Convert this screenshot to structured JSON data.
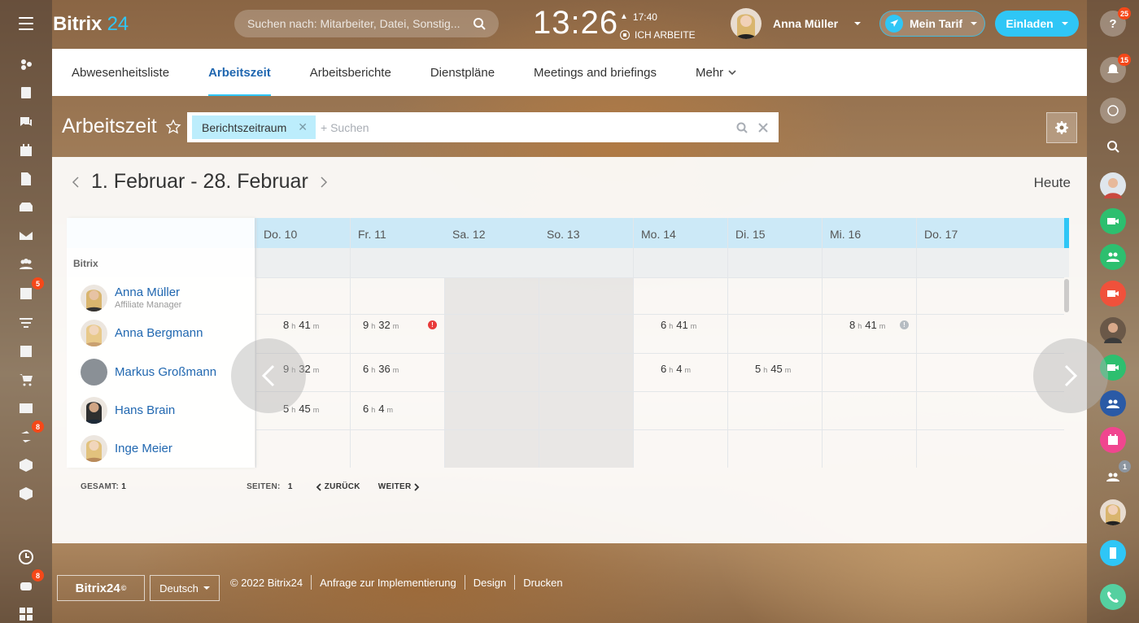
{
  "header": {
    "logo_main": "Bitrix",
    "logo_num": "24",
    "search_placeholder": "Suchen nach: Mitarbeiter, Datei, Sonstig...",
    "clock": "13:26",
    "alarm_time": "17:40",
    "work_status": "ICH ARBEITE",
    "user_name": "Anna Müller",
    "tarif_label": "Mein Tarif",
    "invite_label": "Einladen"
  },
  "left_sidebar": {
    "badges": {
      "tasks": "5",
      "automation": "8",
      "robot": "8"
    }
  },
  "right_sidebar": {
    "badges": {
      "help": "25",
      "notifications": "15",
      "group": "1"
    }
  },
  "tabs": [
    {
      "label": "Abwesenheitsliste"
    },
    {
      "label": "Arbeitszeit"
    },
    {
      "label": "Arbeitsberichte"
    },
    {
      "label": "Dienstpläne"
    },
    {
      "label": "Meetings and briefings"
    },
    {
      "label": "Mehr"
    }
  ],
  "page": {
    "title": "Arbeitszeit",
    "filter_chip": "Berichtszeitraum",
    "filter_placeholder": "+ Suchen"
  },
  "report": {
    "period": "1. Februar - 28. Februar",
    "today_label": "Heute",
    "department": "Bitrix",
    "days": [
      {
        "label": "Do. 10",
        "weekend": false
      },
      {
        "label": "Fr. 11",
        "weekend": false
      },
      {
        "label": "Sa. 12",
        "weekend": true
      },
      {
        "label": "So. 13",
        "weekend": true
      },
      {
        "label": "Mo. 14",
        "weekend": false
      },
      {
        "label": "Di. 15",
        "weekend": false
      },
      {
        "label": "Mi. 16",
        "weekend": false
      },
      {
        "label": "Do. 17",
        "weekend": false
      }
    ],
    "employees": [
      {
        "name": "Anna Müller",
        "role": "Affiliate Manager"
      },
      {
        "name": "Anna Bergmann",
        "role": ""
      },
      {
        "name": "Markus Großmann",
        "role": ""
      },
      {
        "name": "Hans Brain",
        "role": ""
      },
      {
        "name": "Inge Meier",
        "role": ""
      }
    ],
    "entries": [
      {
        "row": 1,
        "day": 0,
        "h": "8",
        "m": "41"
      },
      {
        "row": 1,
        "day": 1,
        "h": "9",
        "m": "32",
        "warning": "red"
      },
      {
        "row": 1,
        "day": 4,
        "h": "6",
        "m": "41"
      },
      {
        "row": 1,
        "day": 6,
        "h": "8",
        "m": "41",
        "warning": "grey"
      },
      {
        "row": 2,
        "day": 0,
        "h": "9",
        "m": "32"
      },
      {
        "row": 2,
        "day": 1,
        "h": "6",
        "m": "36"
      },
      {
        "row": 2,
        "day": 4,
        "h": "6",
        "m": "4"
      },
      {
        "row": 2,
        "day": 5,
        "h": "5",
        "m": "45"
      },
      {
        "row": 3,
        "day": 0,
        "h": "5",
        "m": "45"
      },
      {
        "row": 3,
        "day": 1,
        "h": "6",
        "m": "4"
      }
    ],
    "unit_h": "h",
    "unit_m": "m",
    "total_label": "GESAMT:",
    "total_value": "1",
    "pages_label": "SEITEN:",
    "pages_value": "1",
    "back_label": "ZURÜCK",
    "next_label": "WEITER"
  },
  "footer": {
    "logo": "Bitrix24",
    "language": "Deutsch",
    "copyright": "© 2022 Bitrix24",
    "link_impl": "Anfrage zur Implementierung",
    "link_design": "Design",
    "link_print": "Drucken"
  },
  "colors": {
    "accent": "#2fc6f6",
    "link": "#2067b0",
    "badge": "#f54819",
    "warning_red": "#e83a3a"
  }
}
